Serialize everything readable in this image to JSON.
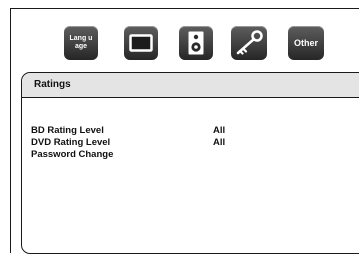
{
  "menu_tabs": [
    {
      "id": "language",
      "label": "Lang uage",
      "icon": "language-icon"
    },
    {
      "id": "display",
      "label": "",
      "icon": "tv-screen-icon"
    },
    {
      "id": "audio",
      "label": "",
      "icon": "speaker-icon"
    },
    {
      "id": "ratings",
      "label": "",
      "icon": "key-icon"
    },
    {
      "id": "other",
      "label": "Other",
      "icon": "other-icon"
    }
  ],
  "panel": {
    "title": "Ratings",
    "rows": [
      {
        "label": "BD  Rating Level",
        "value": "All"
      },
      {
        "label": "DVD Rating Level",
        "value": "All"
      },
      {
        "label": "Password Change",
        "value": ""
      }
    ]
  },
  "colors": {
    "tab_background": "#3a3a3a",
    "panel_header": "#e4e4e4",
    "text": "#111111",
    "border": "#1a1a1a"
  }
}
